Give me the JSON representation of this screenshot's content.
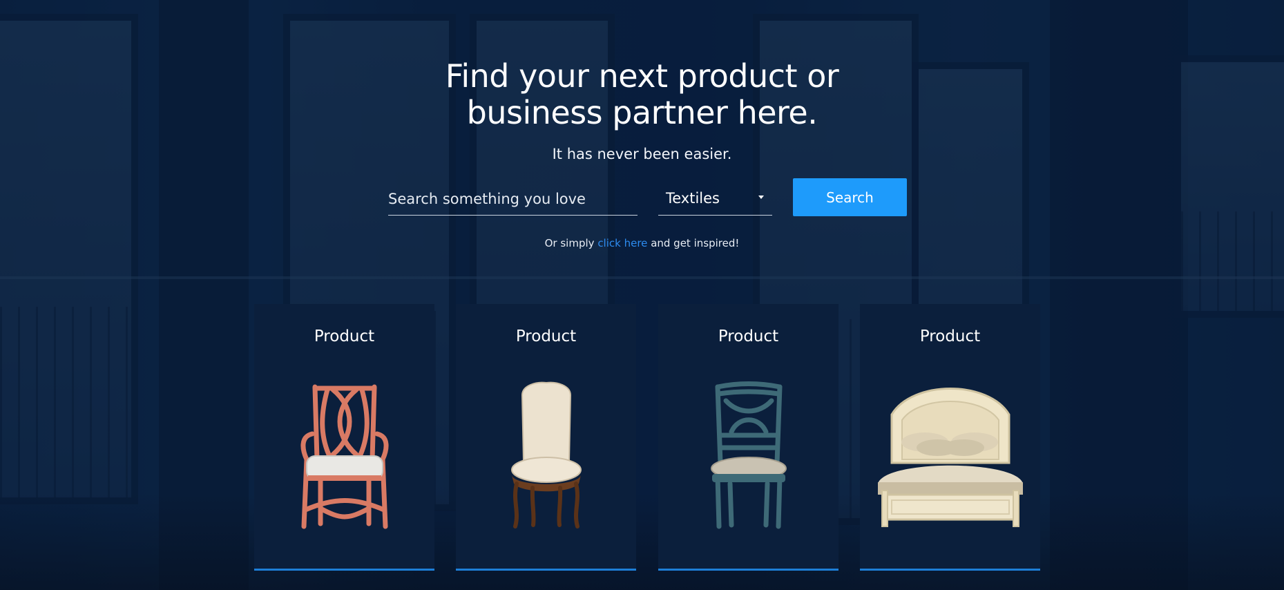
{
  "hero": {
    "headline_line1": "Find your next product or",
    "headline_line2": "business partner here.",
    "subline": "It has never been easier."
  },
  "search": {
    "placeholder": "Search something you love",
    "category_value": "Textiles",
    "button_label": "Search"
  },
  "inspire": {
    "prefix": "Or simply",
    "link_text": "click here",
    "suffix": "and get inspired!"
  },
  "products": [
    {
      "title": "Product",
      "image": "armchair-image"
    },
    {
      "title": "Product",
      "image": "upholstered-chair-image"
    },
    {
      "title": "Product",
      "image": "dining-chair-image"
    },
    {
      "title": "Product",
      "image": "bed-image"
    }
  ],
  "colors": {
    "accent": "#1e9bfb",
    "link": "#2d8cf0",
    "card_background": "#0b1f3c",
    "card_underline": "#1d7fd8"
  }
}
